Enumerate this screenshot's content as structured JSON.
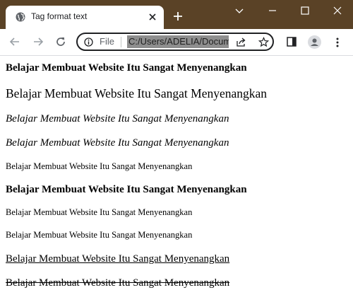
{
  "browser": {
    "tab_title": "Tag format text",
    "scheme_label": "File",
    "url": "C:/Users/ADELIA/Documents/tag-format-text.html"
  },
  "icons": {
    "favicon": "globe-icon",
    "tab_close": "close-icon",
    "new_tab": "plus-icon",
    "minimize": "minimize-icon",
    "maximize": "maximize-icon",
    "window_close": "close-icon",
    "tab_search": "chevron-down-icon",
    "back": "arrow-left-icon",
    "forward": "arrow-right-icon",
    "reload": "reload-icon",
    "site_info": "info-icon",
    "share": "share-icon",
    "bookmark": "star-icon",
    "side_panel": "side-panel-icon",
    "profile": "profile-icon",
    "menu": "kebab-menu-icon"
  },
  "colors": {
    "titlebar": "#5a4226",
    "url_highlight": "#8e8e8e"
  },
  "page": {
    "lines": [
      "Belajar Membuat Website Itu Sangat Menyenangkan",
      "Belajar Membuat Website Itu Sangat Menyenangkan",
      "Belajar Membuat Website Itu Sangat Menyenangkan",
      "Belajar Membuat Website Itu Sangat Menyenangkan",
      "Belajar Membuat Website Itu Sangat Menyenangkan",
      "Belajar Membuat Website Itu Sangat Menyenangkan",
      "Belajar Membuat Website Itu Sangat Menyenangkan",
      "Belajar Membuat Website Itu Sangat Menyenangkan",
      "Belajar Membuat Website Itu Sangat Menyenangkan",
      "Belajar Membuat Website Itu Sangat Menyenangkan"
    ]
  }
}
